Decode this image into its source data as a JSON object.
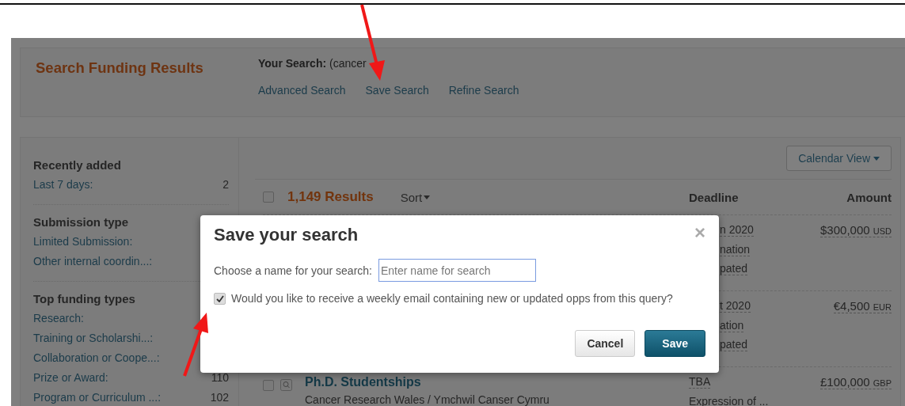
{
  "header": {
    "title": "Search Funding Results",
    "search_label": "Your Search:",
    "search_value": "(cancer",
    "links": [
      "Advanced Search",
      "Save Search",
      "Refine Search"
    ]
  },
  "sidebar": {
    "sections": [
      {
        "heading": "Recently added",
        "items": [
          {
            "label": "Last 7 days:",
            "count": "2"
          }
        ]
      },
      {
        "heading": "Submission type",
        "items": [
          {
            "label": "Limited Submission:"
          },
          {
            "label": "Other internal coordin...:"
          }
        ]
      },
      {
        "heading": "Top funding types",
        "items": [
          {
            "label": "Research:"
          },
          {
            "label": "Training or Scholarshi...:"
          },
          {
            "label": "Collaboration or Coope...:"
          },
          {
            "label": "Prize or Award:",
            "count": "110"
          },
          {
            "label": "Program or Curriculum ...:",
            "count": "102"
          }
        ]
      }
    ]
  },
  "results": {
    "view_button": "Calendar View",
    "count": "1,149 Results",
    "select_all_checked": false,
    "sort": "Sort",
    "columns": [
      "Deadline",
      "Amount"
    ],
    "rows": [
      {
        "deadline": [
          "n 2020",
          "nation",
          "pated"
        ],
        "amount": "$300,000",
        "currency": "USD"
      },
      {
        "deadline": [
          "t 2020",
          "ation",
          "pated"
        ],
        "amount": "€4,500",
        "currency": "EUR"
      },
      {
        "checked": false,
        "title": "Ph.D. Studentships",
        "sponsor": "Cancer Research Wales / Ymchwil Canser Cymru",
        "deadline": [
          "TBA",
          "Expression of ..."
        ],
        "amount": "£100,000",
        "currency": "GBP"
      }
    ]
  },
  "dialog": {
    "title": "Save your search",
    "close": "×",
    "name_label": "Choose a name for your search:",
    "name_placeholder": "Enter name for search",
    "email_checked": true,
    "email_label": "Would you like to receive a weekly email containing new or updated opps from this query?",
    "buttons": [
      "Cancel",
      "Save"
    ]
  }
}
